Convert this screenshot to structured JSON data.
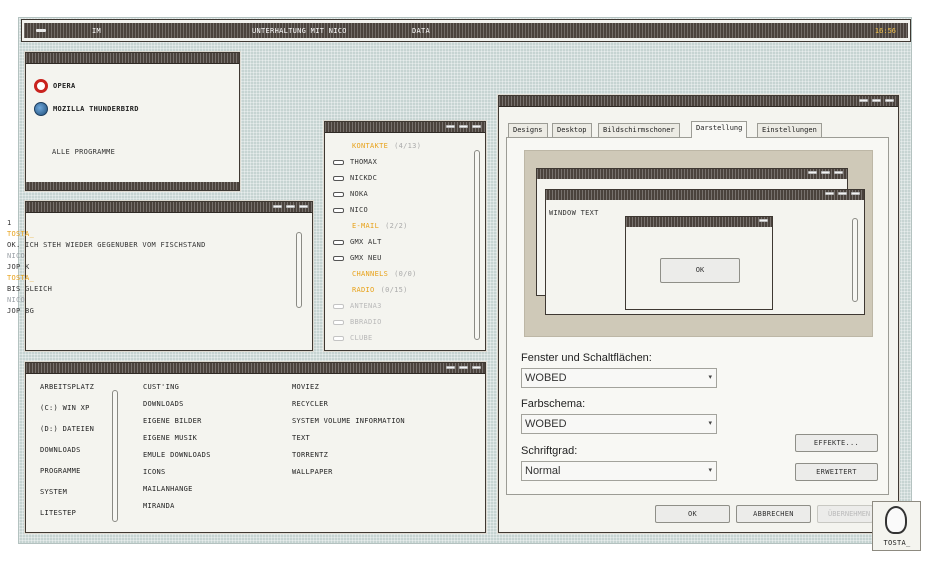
{
  "topbar": {
    "menu": [
      "IM",
      "Unterhaltung mit nico",
      "Data"
    ],
    "clock": "16:56"
  },
  "launcher": {
    "items": [
      "Opera",
      "Mozilla Thunderbird"
    ],
    "all_programs": "Alle Programme"
  },
  "chat": {
    "lines": [
      {
        "text": "1",
        "type": "msg"
      },
      {
        "text": "tosta_",
        "type": "nick-tosta"
      },
      {
        "text": "ok. ich steh wieder gegenuber vom fischstand",
        "type": "msg"
      },
      {
        "text": "nico",
        "type": "nick-nico"
      },
      {
        "text": "jop k",
        "type": "msg"
      },
      {
        "text": "tosta_",
        "type": "nick-tosta"
      },
      {
        "text": "bis gleich",
        "type": "msg"
      },
      {
        "text": "nico",
        "type": "nick-nico"
      },
      {
        "text": "jop bg",
        "type": "msg"
      }
    ]
  },
  "contacts": {
    "rows": [
      {
        "kind": "group",
        "label": "Kontakte",
        "count": "(4/13)"
      },
      {
        "kind": "contact",
        "label": "thomax"
      },
      {
        "kind": "contact",
        "label": "nickdc"
      },
      {
        "kind": "contact",
        "label": "noka"
      },
      {
        "kind": "contact",
        "label": "nico"
      },
      {
        "kind": "group",
        "label": "E-Mail",
        "count": "(2/2)"
      },
      {
        "kind": "contact",
        "label": "gmx alt"
      },
      {
        "kind": "contact",
        "label": "gmx neu"
      },
      {
        "kind": "group",
        "label": "Channels",
        "count": "(0/0)"
      },
      {
        "kind": "group",
        "label": "Radio",
        "count": "(0/15)"
      },
      {
        "kind": "faded",
        "label": "antena3"
      },
      {
        "kind": "faded",
        "label": "bbradio"
      },
      {
        "kind": "faded",
        "label": "clube"
      }
    ]
  },
  "explorer": {
    "col1": [
      "Arbeitsplatz",
      "(C:) Win XP",
      "(D:) Dateien",
      "Downloads",
      "Programme",
      "System",
      "Litestep"
    ],
    "col2": [
      "cust'ing",
      "downloads",
      "eigene bilder",
      "eigene musik",
      "emule downloads",
      "icons",
      "mailanhange",
      "miranda"
    ],
    "col3": [
      "moviez",
      "recycler",
      "system volume information",
      "text",
      "torrentz",
      "wallpaper"
    ]
  },
  "display": {
    "tabs": [
      "Designs",
      "Desktop",
      "Bildschirmschoner",
      "Darstellung",
      "Einstellungen"
    ],
    "active_tab": "Darstellung",
    "preview": {
      "window_text": "Window Text",
      "ok_label": "OK"
    },
    "fields": [
      {
        "label": "Fenster und Schaltflächen:",
        "value": "WOBED"
      },
      {
        "label": "Farbschema:",
        "value": "WOBED"
      },
      {
        "label": "Schriftgrad:",
        "value": "Normal"
      }
    ],
    "effects_label": "Effekte...",
    "advanced_label": "Erweitert",
    "ok_label": "OK",
    "cancel_label": "Abbrechen",
    "apply_label": "Übernehmen"
  },
  "user": {
    "name": "tosta_"
  }
}
